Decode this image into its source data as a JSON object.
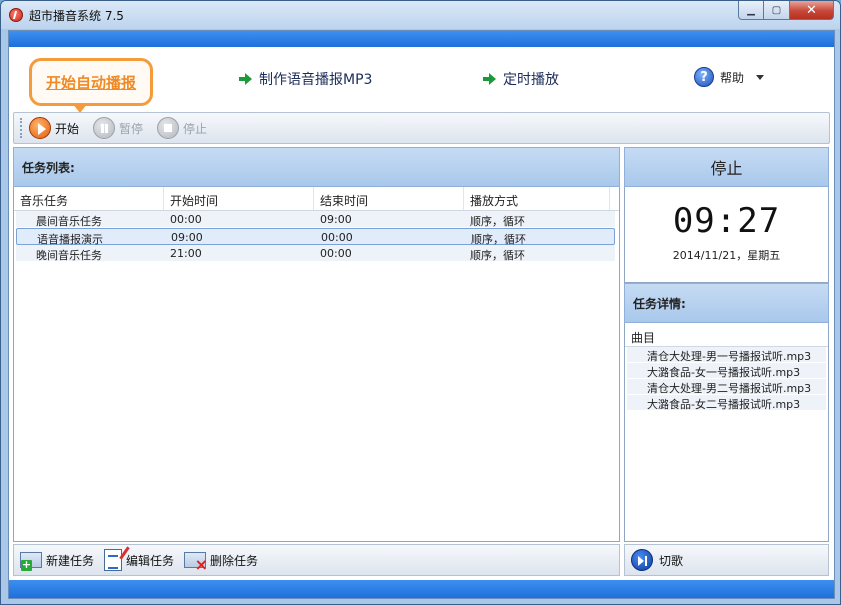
{
  "window": {
    "title": "超市播音系统 7.5"
  },
  "nav": {
    "auto_start": "开始自动播报",
    "make_mp3": "制作语音播报MP3",
    "schedule": "定时播放",
    "help": "帮助"
  },
  "toolbar": {
    "start": "开始",
    "pause": "暂停",
    "stop": "停止"
  },
  "task_list": {
    "title": "任务列表:",
    "columns": [
      "音乐任务",
      "开始时间",
      "结束时间",
      "播放方式"
    ],
    "rows": [
      {
        "name": "晨间音乐任务",
        "start": "00:00",
        "end": "09:00",
        "mode": "顺序，循环"
      },
      {
        "name": "语音播报演示",
        "start": "09:00",
        "end": "00:00",
        "mode": "顺序，循环"
      },
      {
        "name": "晚间音乐任务",
        "start": "21:00",
        "end": "00:00",
        "mode": "顺序，循环"
      }
    ]
  },
  "status": {
    "label": "停止"
  },
  "clock": {
    "time": "09:27",
    "date": "2014/11/21，星期五"
  },
  "details": {
    "title": "任务详情:",
    "column": "曲目",
    "items": [
      "清仓大处理-男一号播报试听.mp3",
      "大潞食品-女一号播报试听.mp3",
      "清仓大处理-男二号播报试听.mp3",
      "大潞食品-女二号播报试听.mp3"
    ]
  },
  "bottom": {
    "new_task": "新建任务",
    "edit_task": "编辑任务",
    "delete_task": "删除任务",
    "next_song": "切歌"
  }
}
